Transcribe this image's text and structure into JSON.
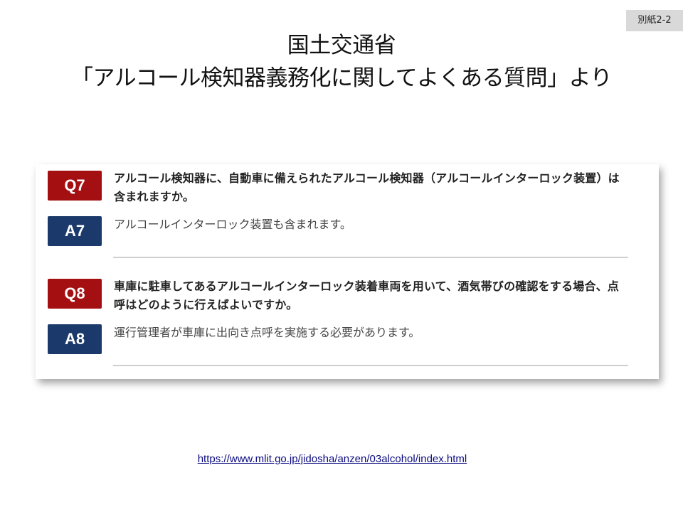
{
  "tag": "別紙2-2",
  "title": {
    "line1": "国土交通省",
    "line2": "「アルコール検知器義務化に関してよくある質問」より"
  },
  "faq": [
    {
      "q_label": "Q7",
      "question": "アルコール検知器に、自動車に備えられたアルコール検知器（アルコールインターロック装置）は含まれますか。",
      "a_label": "A7",
      "answer": "アルコールインターロック装置も含まれます。"
    },
    {
      "q_label": "Q8",
      "question": "車庫に駐車してあるアルコールインターロック装着車両を用いて、酒気帯びの確認をする場合、点呼はどのように行えばよいですか。",
      "a_label": "A8",
      "answer": "運行管理者が車庫に出向き点呼を実施する必要があります。"
    }
  ],
  "source_url": "https://www.mlit.go.jp/jidosha/anzen/03alcohol/index.html",
  "colors": {
    "question_badge": "#a40f12",
    "answer_badge": "#1b3a6b"
  }
}
